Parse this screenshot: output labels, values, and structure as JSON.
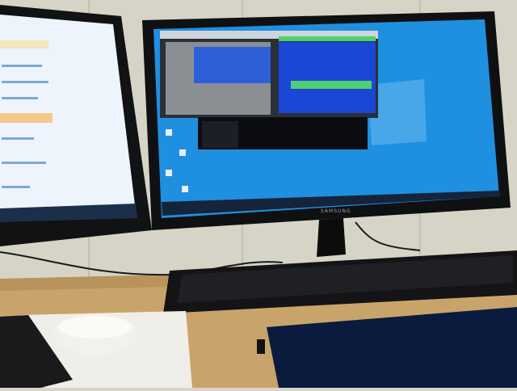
{
  "scene": {
    "description_labels": {
      "right_monitor_brand": "SAMSUNG"
    },
    "colors": {
      "wall": "#d6d4c6",
      "desk": "#c9a46a",
      "monitor_bezel": "#0f1012",
      "desktop_blue": "#1f8fe0",
      "left_screen": "#eef4fb"
    },
    "icons": [
      "window-icon",
      "file-icon",
      "folder-icon",
      "app-icon"
    ]
  }
}
